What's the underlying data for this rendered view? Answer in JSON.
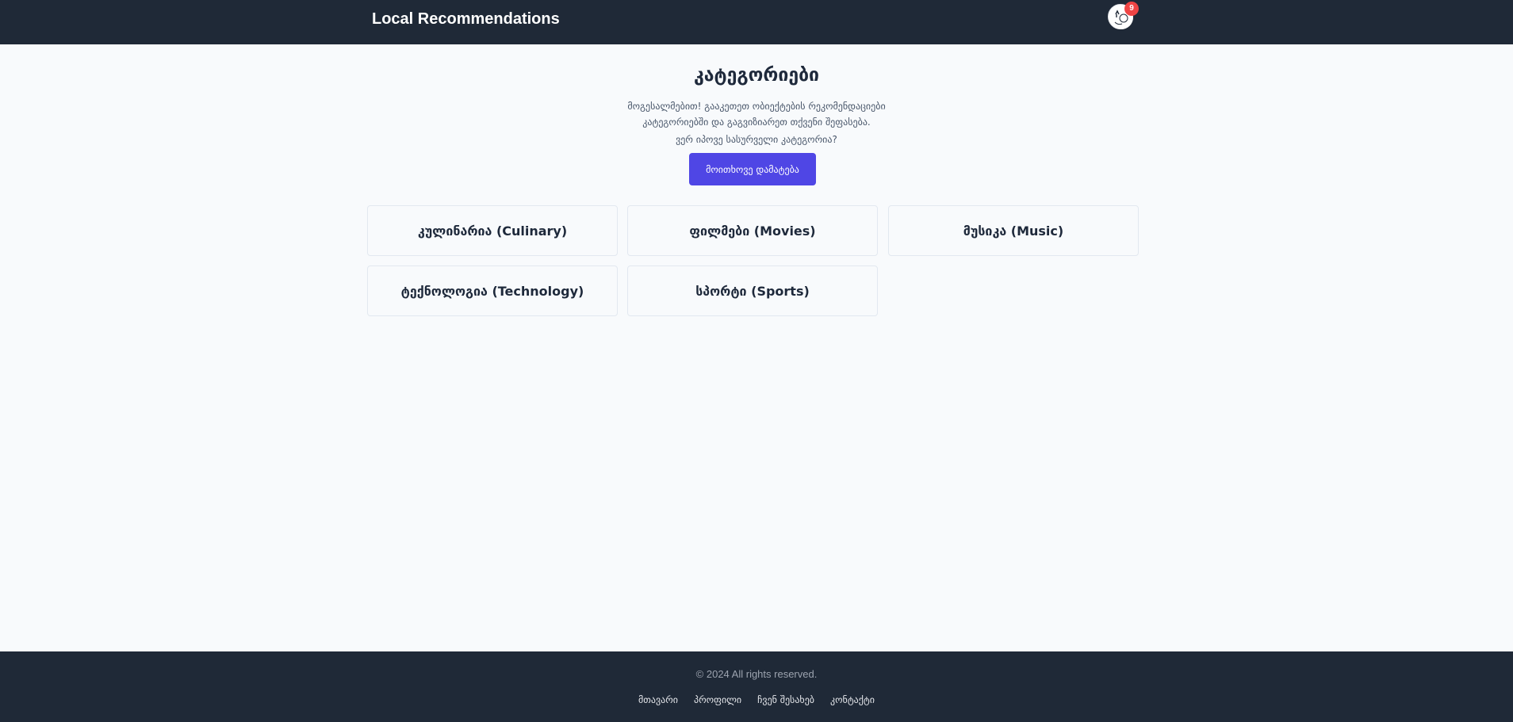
{
  "header": {
    "brand": "Local Recommendations",
    "notification_count": "9",
    "avatar_icon": "user-avatar-icon"
  },
  "main": {
    "title": "კატეგორიები",
    "intro": "მოგესალმებით! გააკეთეთ ობიექტების რეკომენდაციები კატეგორიებში და გაგვიზიარეთ თქვენი შეფასება.",
    "hint": "ვერ იპოვე სასურველი კატეგორია?",
    "request_button": "მოითხოვე დამატება",
    "categories": [
      {
        "label": "კულინარია (Culinary)"
      },
      {
        "label": "ფილმები (Movies)"
      },
      {
        "label": "მუსიკა (Music)"
      },
      {
        "label": "ტექნოლოგია (Technology)"
      },
      {
        "label": "სპორტი (Sports)"
      }
    ]
  },
  "footer": {
    "copyright": "© 2024 All rights reserved.",
    "links": [
      "მთავარი",
      "პროფილი",
      "ჩვენ შესახებ",
      "კონტაქტი"
    ]
  },
  "colors": {
    "nav_bg": "#1f2937",
    "accent": "#4f46e5",
    "badge": "#ef4444",
    "page_bg": "#f8fafc"
  }
}
